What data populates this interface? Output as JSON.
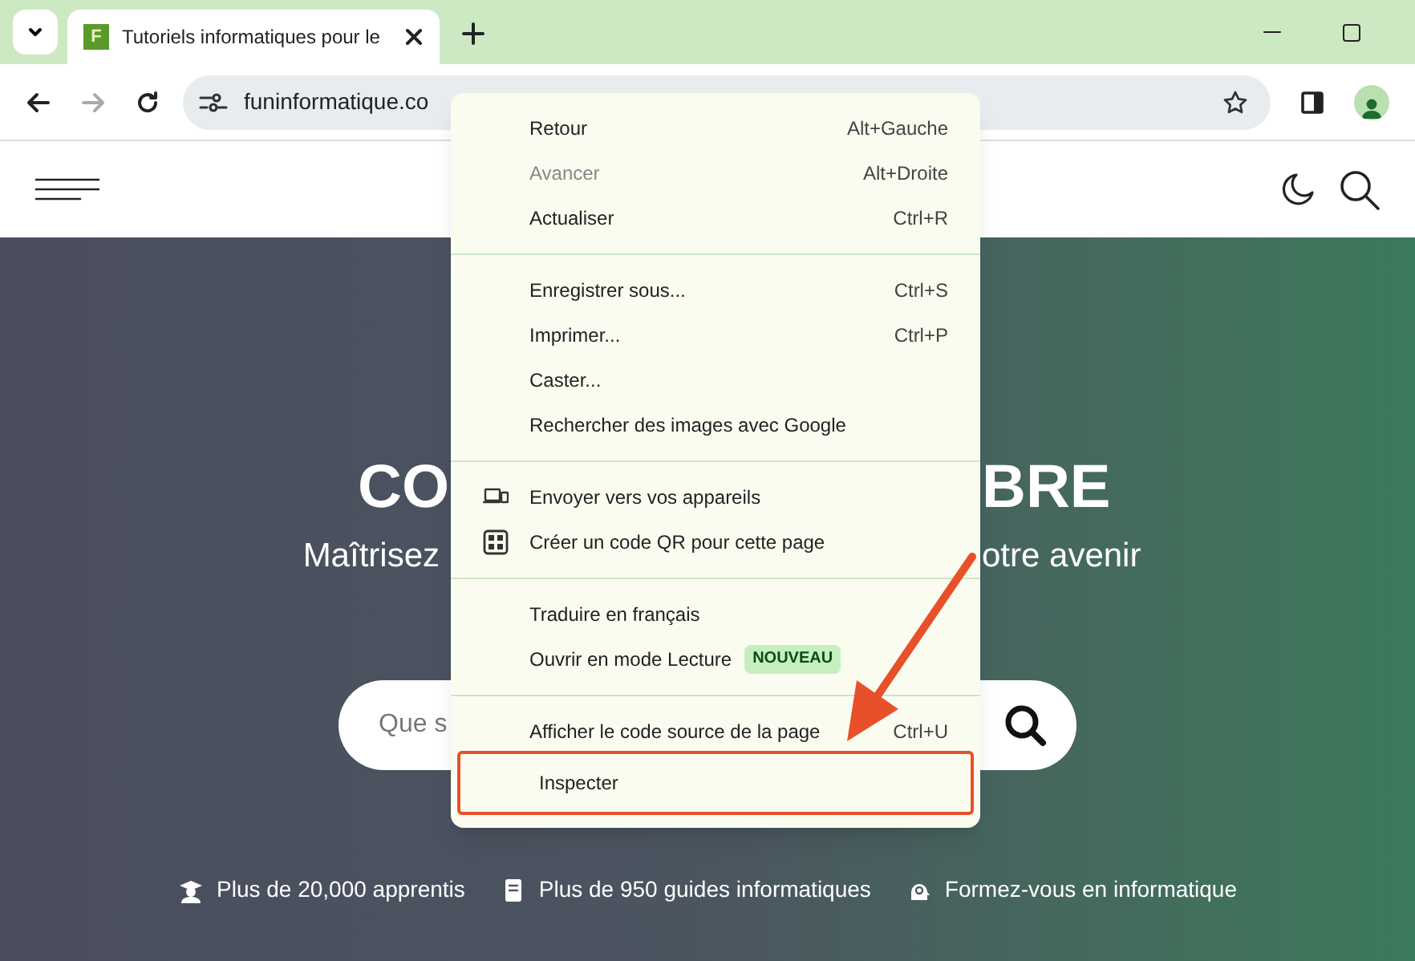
{
  "browser": {
    "tab": {
      "title": "Tutoriels informatiques pour le",
      "favicon": "F"
    },
    "address": "funinformatique.co",
    "forward_disabled": true
  },
  "site": {
    "heading_left": "CO",
    "heading_right": "BRE",
    "subtitle_left": "Maîtrisez",
    "subtitle_right": "otre avenir",
    "search_placeholder": "Que s",
    "stats": [
      {
        "kind": "student",
        "text": "Plus de 20,000 apprentis"
      },
      {
        "kind": "book",
        "text": "Plus de 950 guides informatiques"
      },
      {
        "kind": "brain",
        "text": "Formez-vous en informatique"
      }
    ]
  },
  "context_menu": {
    "sections": [
      [
        {
          "label": "Retour",
          "shortcut": "Alt+Gauche",
          "disabled": false,
          "highlighted": false
        },
        {
          "label": "Avancer",
          "shortcut": "Alt+Droite",
          "disabled": true,
          "highlighted": false
        },
        {
          "label": "Actualiser",
          "shortcut": "Ctrl+R",
          "disabled": false,
          "highlighted": false
        }
      ],
      [
        {
          "label": "Enregistrer sous...",
          "shortcut": "Ctrl+S",
          "disabled": false,
          "highlighted": false
        },
        {
          "label": "Imprimer...",
          "shortcut": "Ctrl+P",
          "disabled": false,
          "highlighted": false
        },
        {
          "label": "Caster...",
          "disabled": false,
          "highlighted": false
        },
        {
          "label": "Rechercher des images avec Google",
          "disabled": false,
          "highlighted": false
        }
      ],
      [
        {
          "label": "Envoyer vers vos appareils",
          "kind": "devices",
          "disabled": false,
          "highlighted": false
        },
        {
          "label": "Créer un code QR pour cette page",
          "kind": "qr",
          "disabled": false,
          "highlighted": false
        }
      ],
      [
        {
          "label": "Traduire en français",
          "disabled": false,
          "highlighted": false
        },
        {
          "label": "Ouvrir en mode Lecture",
          "badge": "NOUVEAU",
          "disabled": false,
          "highlighted": false
        }
      ],
      [
        {
          "label": "Afficher le code source de la page",
          "shortcut": "Ctrl+U",
          "disabled": false,
          "highlighted": false
        },
        {
          "label": "Inspecter",
          "disabled": false,
          "highlighted": true
        }
      ]
    ]
  }
}
